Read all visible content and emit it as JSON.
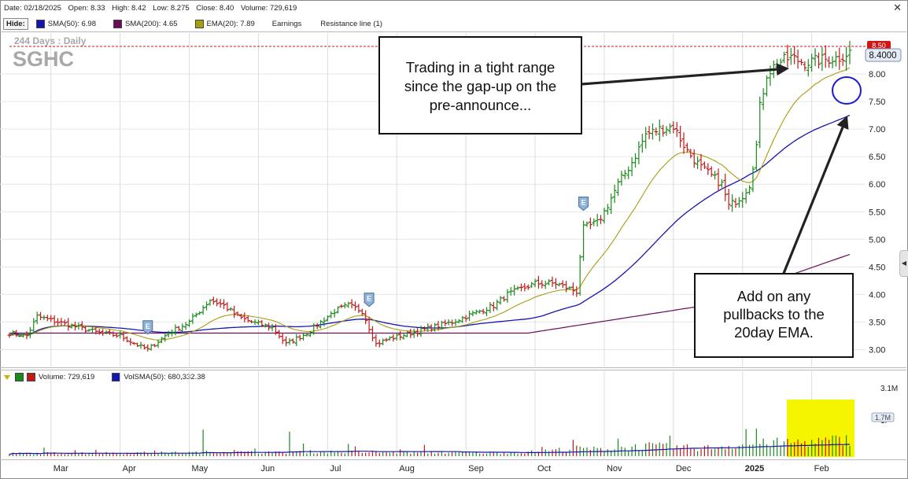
{
  "info_bar": {
    "date": "Date: 02/18/2025",
    "open": "Open: 8.33",
    "high": "High: 8.42",
    "low": "Low: 8.275",
    "close": "Close: 8.40",
    "volume": "Volume: 729,619"
  },
  "legend": {
    "hide": "Hide:",
    "sma50": "SMA(50): 6.98",
    "sma200": "SMA(200): 4.65",
    "ema20": "EMA(20): 7.89",
    "earnings": "Earnings",
    "resistance": "Resistance line (1)"
  },
  "watermark": {
    "period": "244  Days : Daily",
    "symbol": "SGHC"
  },
  "price_tag": {
    "last": "8.4000",
    "resistance": "8.50"
  },
  "annotations": {
    "box1": [
      "Trading in a tight range",
      "since the gap-up on the",
      "pre-announce..."
    ],
    "box2": [
      "Add on any",
      "pullbacks to the",
      "20day EMA."
    ]
  },
  "volume_legend": {
    "volume": "Volume: 729,619",
    "volsma": "VolSMA(50): 680,332.38",
    "max": "3.1M",
    "mid": "1.",
    "tag": "1.7M"
  },
  "earnings_marker": "E",
  "colors": {
    "up": "#1a8a1a",
    "down": "#c21818",
    "sma50": "#1515b0",
    "sma200": "#6a0c5a",
    "ema20": "#a89d10",
    "resistance": "#d01515",
    "highlight": "#f5f500",
    "circle": "#1a1ad0"
  },
  "chart_data": {
    "type": "ohlc",
    "y_ticks": [
      3.0,
      3.5,
      4.0,
      4.5,
      5.0,
      5.5,
      6.0,
      6.5,
      7.0,
      7.5,
      8.0
    ],
    "y_tick_labels": [
      "3.00",
      "3.50",
      "4.00",
      "4.50",
      "5.00",
      "5.50",
      "6.00",
      "6.50",
      "7.00",
      "7.50",
      "8.00"
    ],
    "ylim": [
      2.75,
      8.7
    ],
    "resistance_level": 8.5,
    "x_label_days": [
      12,
      32,
      52,
      72,
      92,
      112,
      132,
      152,
      172,
      192,
      212,
      232
    ],
    "x_labels": [
      "Mar",
      "Apr",
      "May",
      "Jun",
      "Jul",
      "Aug",
      "Sep",
      "Oct",
      "Nov",
      "Dec",
      "2025",
      "Feb"
    ],
    "earnings_days": [
      40,
      104,
      166
    ],
    "anchors_close": [
      [
        0,
        3.3
      ],
      [
        5,
        3.25
      ],
      [
        8,
        3.6
      ],
      [
        14,
        3.5
      ],
      [
        20,
        3.4
      ],
      [
        26,
        3.3
      ],
      [
        32,
        3.25
      ],
      [
        38,
        3.05
      ],
      [
        40,
        3.0
      ],
      [
        46,
        3.3
      ],
      [
        52,
        3.5
      ],
      [
        58,
        3.9
      ],
      [
        62,
        3.8
      ],
      [
        66,
        3.6
      ],
      [
        70,
        3.5
      ],
      [
        76,
        3.4
      ],
      [
        80,
        3.1
      ],
      [
        86,
        3.3
      ],
      [
        90,
        3.5
      ],
      [
        94,
        3.7
      ],
      [
        98,
        3.8
      ],
      [
        102,
        3.7
      ],
      [
        106,
        3.1
      ],
      [
        110,
        3.2
      ],
      [
        116,
        3.3
      ],
      [
        122,
        3.4
      ],
      [
        128,
        3.5
      ],
      [
        132,
        3.6
      ],
      [
        136,
        3.7
      ],
      [
        140,
        3.8
      ],
      [
        144,
        4.0
      ],
      [
        148,
        4.1
      ],
      [
        152,
        4.2
      ],
      [
        158,
        4.2
      ],
      [
        164,
        4.05
      ],
      [
        165,
        4.7
      ],
      [
        166,
        5.2
      ],
      [
        170,
        5.3
      ],
      [
        172,
        5.5
      ],
      [
        176,
        6.0
      ],
      [
        180,
        6.4
      ],
      [
        184,
        6.9
      ],
      [
        188,
        7.0
      ],
      [
        192,
        7.05
      ],
      [
        196,
        6.6
      ],
      [
        200,
        6.3
      ],
      [
        204,
        6.1
      ],
      [
        206,
        6.0
      ],
      [
        208,
        5.6
      ],
      [
        212,
        5.8
      ],
      [
        214,
        6.0
      ],
      [
        216,
        6.7
      ],
      [
        217,
        7.4
      ],
      [
        219,
        8.0
      ],
      [
        222,
        8.2
      ],
      [
        226,
        8.3
      ],
      [
        230,
        8.2
      ],
      [
        234,
        8.25
      ],
      [
        240,
        8.3
      ],
      [
        243,
        8.4
      ]
    ],
    "anchors_volume": [
      [
        0,
        0.12
      ],
      [
        30,
        0.14
      ],
      [
        55,
        0.16
      ],
      [
        56,
        0.85
      ],
      [
        57,
        0.2
      ],
      [
        80,
        0.15
      ],
      [
        81,
        1.1
      ],
      [
        82,
        0.2
      ],
      [
        100,
        0.18
      ],
      [
        140,
        0.15
      ],
      [
        150,
        0.18
      ],
      [
        165,
        0.35
      ],
      [
        170,
        0.3
      ],
      [
        185,
        0.45
      ],
      [
        200,
        0.35
      ],
      [
        216,
        0.55
      ],
      [
        225,
        0.6
      ],
      [
        235,
        0.65
      ],
      [
        243,
        0.73
      ]
    ],
    "volume_max": 3.1
  }
}
